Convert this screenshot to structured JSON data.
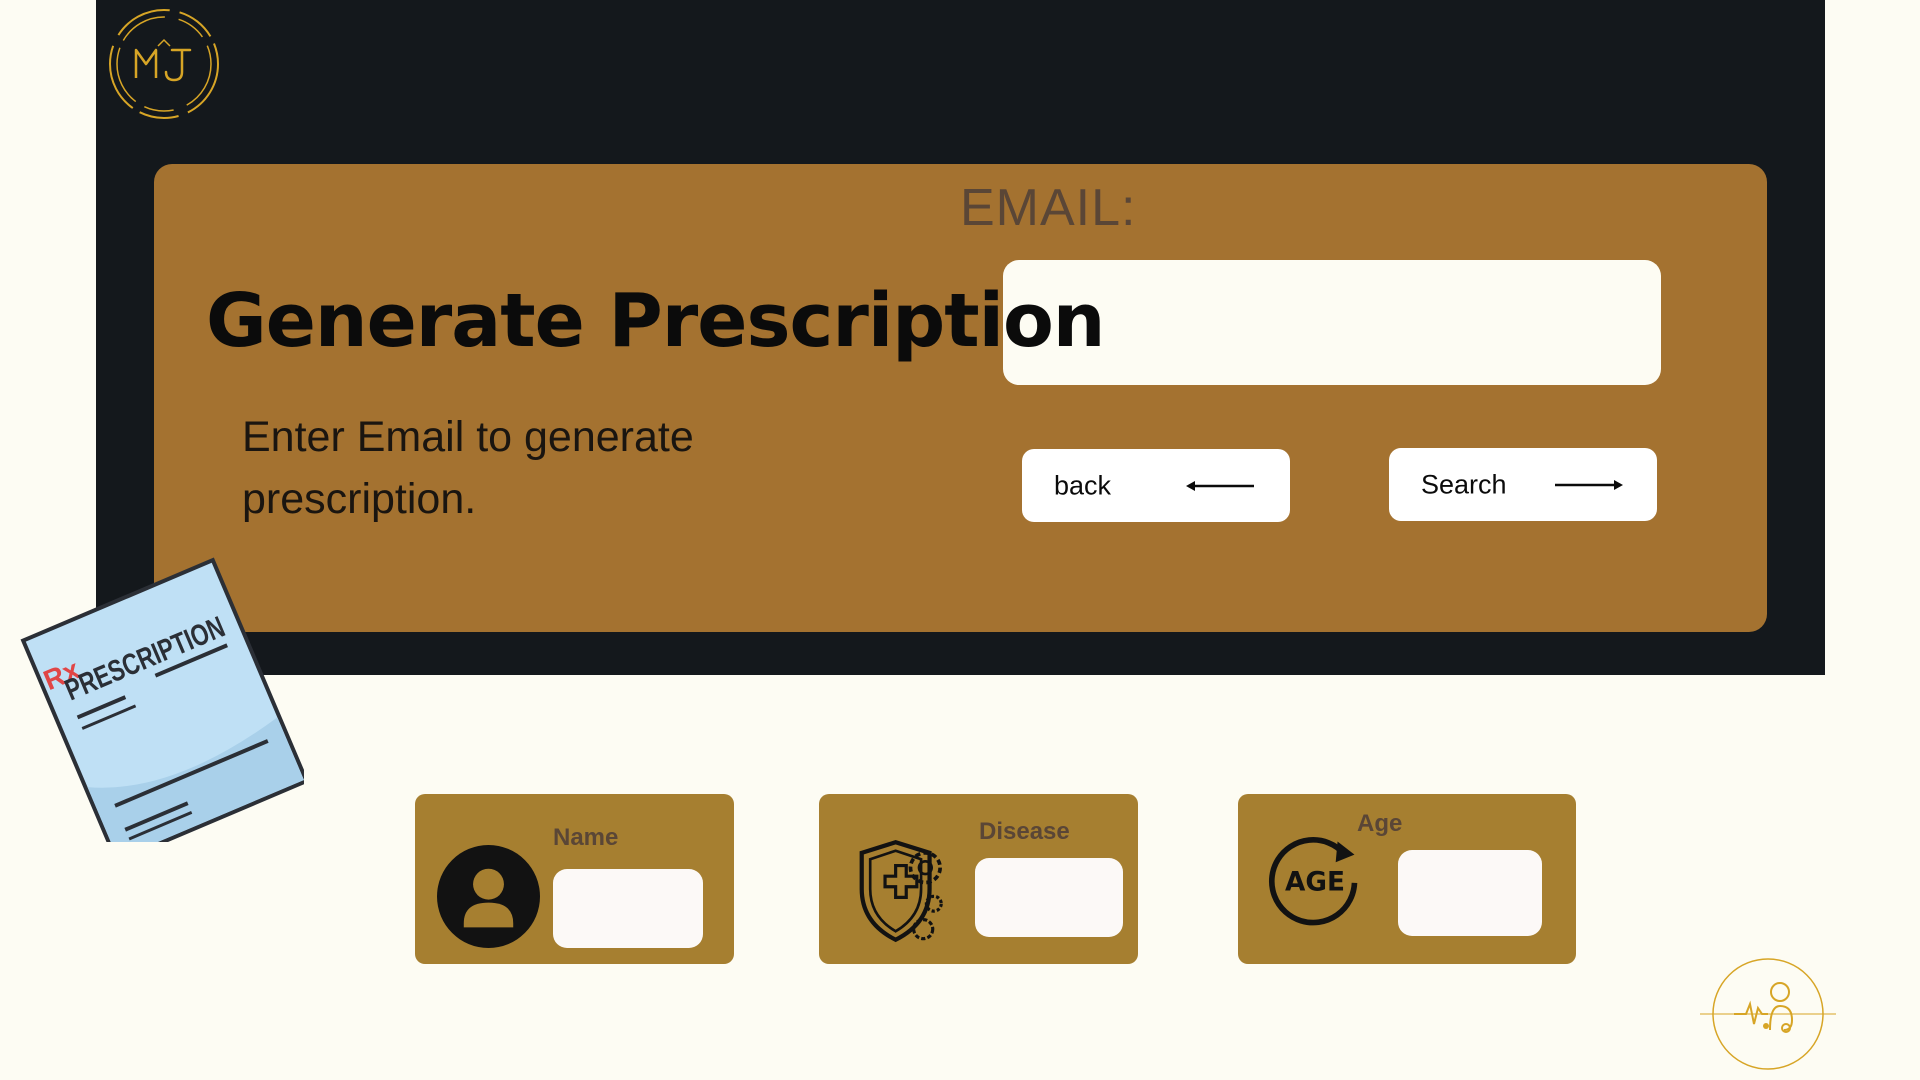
{
  "colors": {
    "page_background": "#fdfcf3",
    "dark_panel": "#14181c",
    "card_brown": "#a47230",
    "field_card_brown": "#a67f30",
    "gold_accent": "#d7a526",
    "label_text": "#5a4636"
  },
  "header": {
    "logo_icon": "mj-monogram-logo"
  },
  "main": {
    "title": "Generate Prescription",
    "email_label": "EMAIL:",
    "email_input_value": "",
    "instructions": "Enter Email to generate prescription.",
    "back_button_label": "back",
    "back_button_icon": "arrow-left-icon",
    "search_button_label": "Search",
    "search_button_icon": "arrow-right-icon"
  },
  "illustration": {
    "rx_label": "Rx",
    "paper_title": "PRESCRIPTION"
  },
  "fields": {
    "name": {
      "label": "Name",
      "value": "",
      "icon": "user-icon"
    },
    "disease": {
      "label": "Disease",
      "value": "",
      "icon": "medical-shield-icon"
    },
    "age": {
      "label": "Age",
      "value": "",
      "icon_text": "AGE",
      "icon": "age-cycle-icon"
    }
  },
  "footer": {
    "logo_icon": "doctor-heartbeat-logo"
  }
}
